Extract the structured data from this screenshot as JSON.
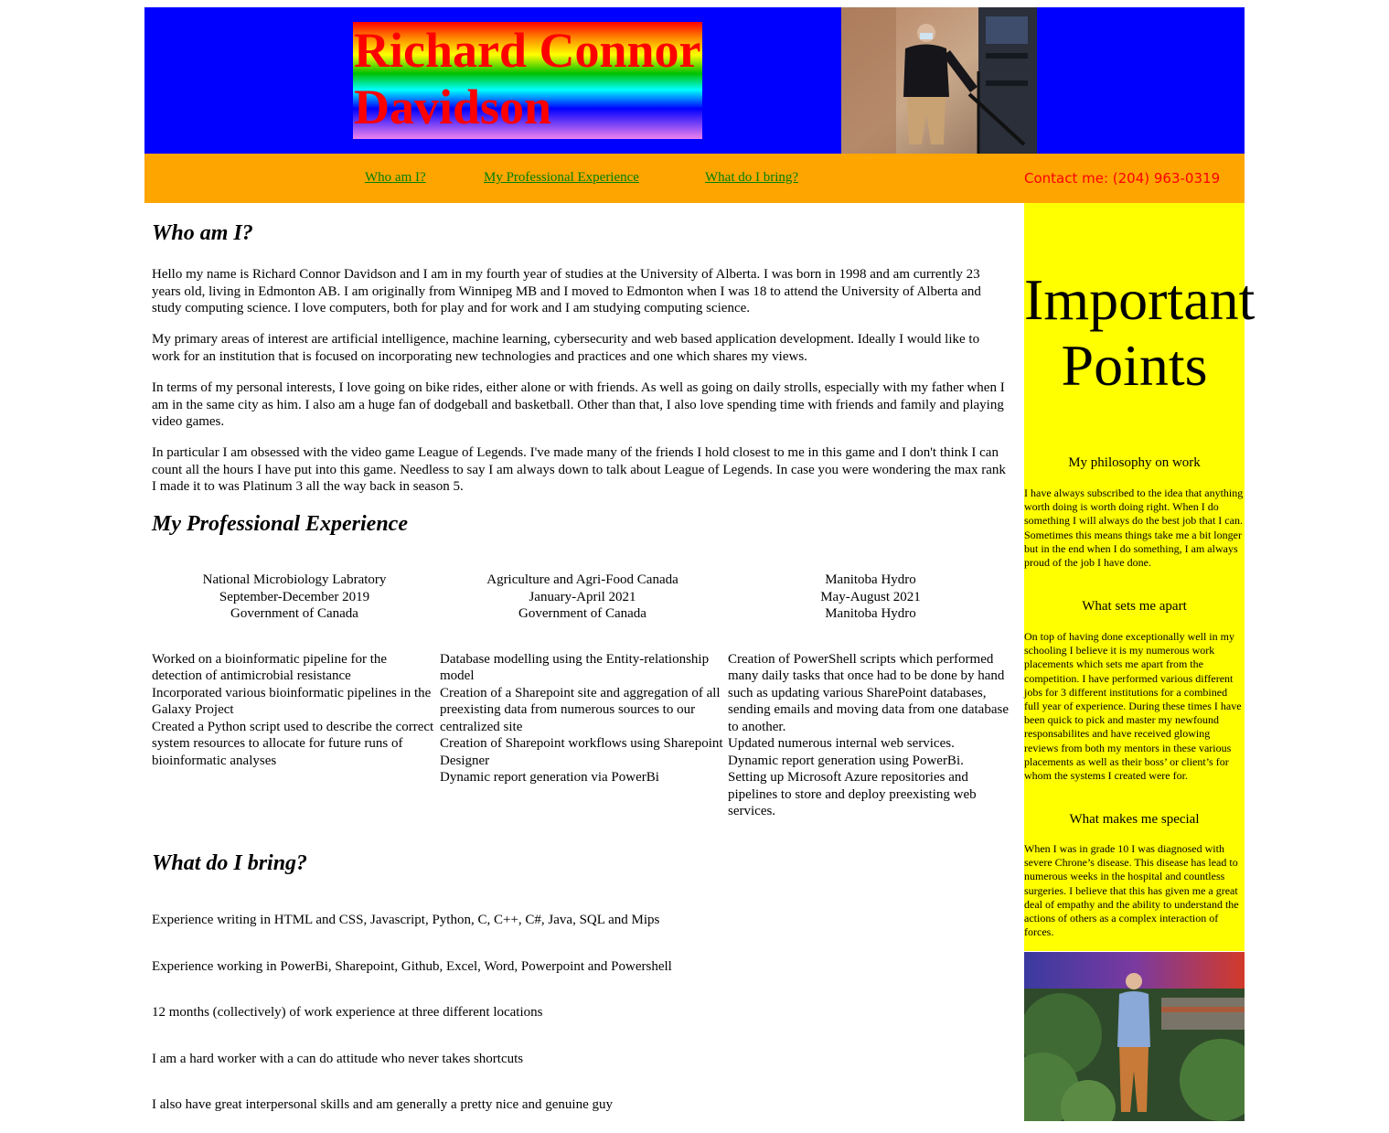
{
  "header": {
    "name": "Richard Connor Davidson",
    "name_line1": "Richard Connor",
    "name_line2": "Davidson",
    "photo_alt": "Richard standing beside a stair railing wearing a mask"
  },
  "nav": {
    "links": [
      {
        "label": "Who am I?"
      },
      {
        "label": "My Professional Experience"
      },
      {
        "label": "What do I bring?"
      }
    ],
    "contact": "Contact me: (204) 963-0319"
  },
  "who": {
    "heading": "Who am I?",
    "paragraphs": [
      "Hello my name is Richard Connor Davidson and I am in my fourth year of studies at the University of Alberta. I was born in 1998 and am currently 23 years old, living in Edmonton AB. I am originally from Winnipeg MB and I moved to Edmonton when I was 18 to attend the University of Alberta and study computing science. I love computers, both for play and for work and I am studying computing science.",
      "My primary areas of interest are artificial intelligence, machine learning, cybersecurity and web based application development. Ideally I would like to work for an institution that is focused on incorporating new technologies and practices and one which shares my views.",
      "In terms of my personal interests, I love going on bike rides, either alone or with friends. As well as going on daily strolls, especially with my father when I am in the same city as him. I also am a huge fan of dodgeball and basketball. Other than that, I also love spending time with friends and family and playing video games.",
      "In particular I am obsessed with the video game League of Legends. I've made many of the friends I hold closest to me in this game and I don't think I can count all the hours I have put into this game. Needless to say I am always down to talk about League of Legends. In case you were wondering the max rank I made it to was Platinum 3 all the way back in season 5."
    ]
  },
  "experience": {
    "heading": "My Professional Experience",
    "jobs": [
      {
        "org": "National Microbiology Labratory",
        "dates": "September-December 2019",
        "employer": "Government of Canada",
        "tasks": [
          "Worked on a bioinformatic pipeline for the detection of antimicrobial resistance",
          "Incorporated various bioinformatic pipelines in the Galaxy Project",
          "Created a Python script used to describe the correct system resources to allocate for future runs of bioinformatic analyses"
        ]
      },
      {
        "org": "Agriculture and Agri-Food Canada",
        "dates": "January-April 2021",
        "employer": "Government of Canada",
        "tasks": [
          "Database modelling using the Entity-relationship model",
          "Creation of a Sharepoint site and aggregation of all preexisting data from numerous sources to our centralized site",
          "Creation of Sharepoint workflows using Sharepoint Designer",
          "Dynamic report generation via PowerBi"
        ]
      },
      {
        "org": "Manitoba Hydro",
        "dates": "May-August 2021",
        "employer": "Manitoba Hydro",
        "tasks": [
          "Creation of PowerShell scripts which performed many daily tasks that once had to be done by hand such as updating various SharePoint databases, sending emails and moving data from one database to another.",
          "Updated numerous internal web services.",
          "Dynamic report generation using PowerBi.",
          "Setting up Microsoft Azure repositories and pipelines to store and deploy preexisting web services."
        ]
      }
    ]
  },
  "bring": {
    "heading": "What do I bring?",
    "items": [
      "Experience writing in HTML and CSS, Javascript, Python, C, C++, C#, Java, SQL and Mips",
      "Experience working in PowerBi, Sharepoint, Github, Excel, Word, Powerpoint and Powershell",
      "12 months (collectively) of work experience at three different locations",
      "I am a hard worker with a can do attitude who never takes shortcuts",
      "I also have great interpersonal skills and am generally a pretty nice and genuine guy"
    ]
  },
  "sidebar": {
    "title_line1": "Important",
    "title_line2": "Points",
    "sections": [
      {
        "heading": "My philosophy on work",
        "text": "I have always subscribed to the idea that anything worth doing is worth doing right. When I do something I will always do the best job that I can. Sometimes this means things take me a bit longer but in the end when I do something, I am always proud of the job I have done."
      },
      {
        "heading": "What sets me apart",
        "text": "On top of having done exceptionally well in my schooling I believe it is my numerous work placements which sets me apart from the competition. I have performed various different jobs for 3 different institutions for a combined full year of experience. During these times I have been quick to pick and master my newfound responsabilites and have received glowing reviews from both my mentors in these various placements as well as their boss’ or client’s for whom the systems I created were for."
      },
      {
        "heading": "What makes me special",
        "text": "When I was in grade 10 I was diagnosed with severe Chrone’s disease. This disease has lead to numerous weeks in the hospital and countless surgeries. I believe that this has given me a great deal of empathy and the ability to understand the actions of others as a complex interaction of forces."
      }
    ],
    "photo_alt": "Richard standing in a garden"
  },
  "colors": {
    "header_bg": "#0000ff",
    "nav_bg": "#ffa500",
    "sidebar_bg": "#ffff00",
    "link": "#008000",
    "contact": "#ff0000",
    "title_text": "#ff0000"
  }
}
